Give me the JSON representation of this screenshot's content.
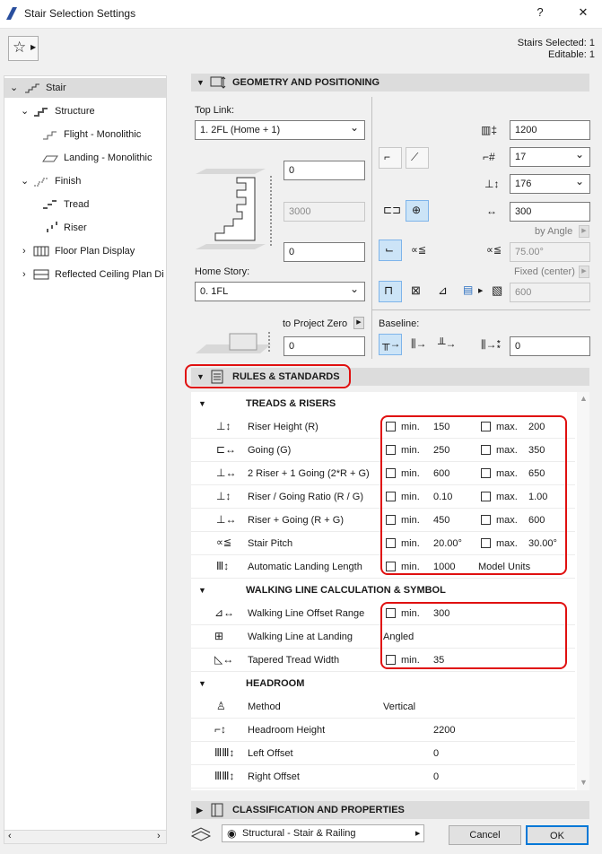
{
  "window": {
    "title": "Stair Selection Settings",
    "help": "?",
    "close": "✕"
  },
  "selection": {
    "selected": "Stairs Selected: 1",
    "editable": "Editable: 1"
  },
  "tree": [
    {
      "label": "Stair",
      "level": 0,
      "arrow": "⌄"
    },
    {
      "label": "Structure",
      "level": 1,
      "arrow": "⌄"
    },
    {
      "label": "Flight - Monolithic",
      "level": 2,
      "arrow": ""
    },
    {
      "label": "Landing - Monolithic",
      "level": 2,
      "arrow": ""
    },
    {
      "label": "Finish",
      "level": 1,
      "arrow": "⌄"
    },
    {
      "label": "Tread",
      "level": 2,
      "arrow": ""
    },
    {
      "label": "Riser",
      "level": 2,
      "arrow": ""
    },
    {
      "label": "Floor Plan Display",
      "level": 1,
      "arrow": "›"
    },
    {
      "label": "Reflected Ceiling Plan Di",
      "level": 1,
      "arrow": "›"
    }
  ],
  "geometry": {
    "header": "GEOMETRY AND POSITIONING",
    "top_link_label": "Top Link:",
    "top_link_value": "1. 2FL (Home + 1)",
    "top_offset": "0",
    "height": "3000",
    "bottom_offset": "0",
    "home_story_label": "Home Story:",
    "home_story_value": "0. 1FL",
    "to_project_zero": "to Project Zero",
    "project_zero_value": "0",
    "width": "1200",
    "riser_count": "17",
    "riser_height": "176",
    "going": "300",
    "by_angle": "by Angle",
    "pitch": "75.00°",
    "fixed_center": "Fixed (center)",
    "fixed_value": "600",
    "baseline_label": "Baseline:",
    "baseline_value": "0"
  },
  "rules": {
    "header": "RULES & STANDARDS",
    "treads_header": "TREADS & RISERS",
    "treads": [
      {
        "label": "Riser Height (R)",
        "min": "150",
        "max": "200"
      },
      {
        "label": "Going (G)",
        "min": "250",
        "max": "350"
      },
      {
        "label": "2 Riser + 1 Going (2*R + G)",
        "min": "600",
        "max": "650"
      },
      {
        "label": "Riser / Going Ratio (R / G)",
        "min": "0.10",
        "max": "1.00"
      },
      {
        "label": "Riser + Going (R + G)",
        "min": "450",
        "max": "600"
      },
      {
        "label": "Stair Pitch",
        "min": "20.00°",
        "max": "30.00°"
      }
    ],
    "landing": {
      "label": "Automatic Landing Length",
      "min": "1000",
      "units": "Model Units"
    },
    "walking_header": "WALKING LINE CALCULATION & SYMBOL",
    "walking_offset": {
      "label": "Walking Line Offset Range",
      "min": "300"
    },
    "walking_landing": {
      "label": "Walking Line at Landing",
      "value": "Angled"
    },
    "tapered": {
      "label": "Tapered Tread Width",
      "min": "35"
    },
    "headroom_header": "HEADROOM",
    "method": {
      "label": "Method",
      "value": "Vertical"
    },
    "headroom_height": {
      "label": "Headroom Height",
      "value": "2200"
    },
    "left_offset": {
      "label": "Left Offset",
      "value": "0"
    },
    "right_offset": {
      "label": "Right Offset",
      "value": "0"
    },
    "min_label": "min.",
    "max_label": "max."
  },
  "classification": {
    "header": "CLASSIFICATION AND PROPERTIES"
  },
  "footer": {
    "layer": "Structural - Stair & Railing",
    "cancel": "Cancel",
    "ok": "OK"
  }
}
